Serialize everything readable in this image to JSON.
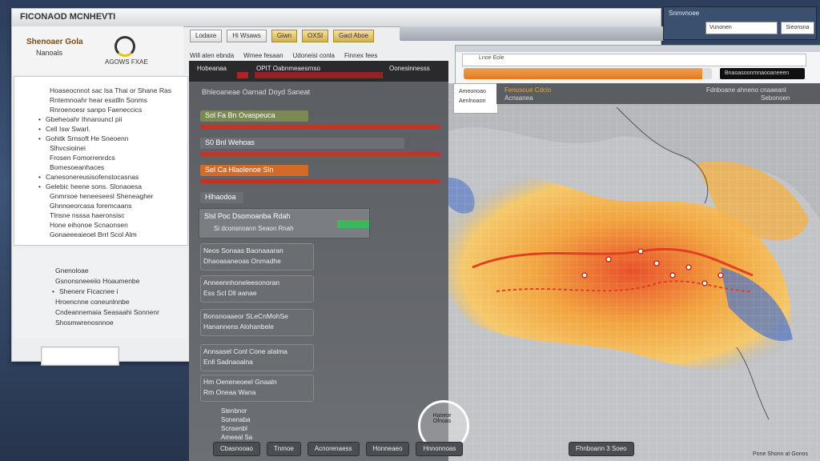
{
  "window": {
    "title": "FICONAOD MCNHEVTI"
  },
  "brand": {
    "name": "Shenoaer Gola",
    "sub": "Nanoals",
    "logo_text": "AGOWS FXAE"
  },
  "toolbar": {
    "buttons": [
      {
        "label": "Lodaxe",
        "style": "plain"
      },
      {
        "label": "Hi Wsaws",
        "style": "plain"
      },
      {
        "label": "Giwn",
        "style": "gold"
      },
      {
        "label": "OXSI",
        "style": "gold"
      },
      {
        "label": "Gacl Aboe",
        "style": "gold"
      }
    ]
  },
  "sub_toolbar": [
    "Will aten ebnda",
    "Wmee fesaan",
    "Udoneisi conla",
    "Finnex fees"
  ],
  "left_list": {
    "items": [
      {
        "text": "Hoaseocnnot sac lsa Thai or Shane Ras",
        "bullet": false
      },
      {
        "text": "Rntemnoahr hear esatlln Sonms",
        "bullet": false
      },
      {
        "text": "Rnroenoesr sanpo Faeneccics",
        "bullet": false
      },
      {
        "text": "Gbeheoahr Ihnarouncl pii",
        "bullet": true
      },
      {
        "text": "Cell Isw Swarl.",
        "bullet": true
      },
      {
        "text": "Gohitk Srnsoft He Sneoenn",
        "bullet": true
      },
      {
        "text": "Slhvcsioinei",
        "bullet": false
      },
      {
        "text": "Frosen Fomorrenrdcs",
        "bullet": false
      },
      {
        "text": "Bomesoeanhaces",
        "bullet": false
      },
      {
        "text": "Canesonereusisofenstocasnas",
        "bullet": true
      },
      {
        "text": "Gelebic heene sons. Slonaoesa",
        "bullet": true
      },
      {
        "text": "Gnmrsoe heneeseesl Sheneagher",
        "bullet": false
      },
      {
        "text": "Ghnnoeorcasa foremcaans",
        "bullet": false
      },
      {
        "text": "Tlnsne nsssa haeronsisc",
        "bullet": false
      },
      {
        "text": "Hone eihonoe Scnaonsen",
        "bullet": false
      },
      {
        "text": "Gonaeeeaieoel Brrl Scol Alm",
        "bullet": false
      }
    ]
  },
  "left_list2": {
    "items": [
      {
        "text": "Gnenoloae",
        "bullet": false
      },
      {
        "text": "Gsnonsneeeiio Hoaumenbe",
        "bullet": false
      },
      {
        "text": "Shenenr Ficacnee i",
        "bullet": true
      },
      {
        "text": "Hroencnne coneunlnnbe",
        "bullet": false
      },
      {
        "text": "Cndeannemaia Seasaahi Sonnenr",
        "bullet": false
      },
      {
        "text": "Shosmwrenosnnoe",
        "bullet": false
      }
    ]
  },
  "mid_panel": {
    "tabs": [
      "Hobeanaa",
      "OPIT Oabnmeaesrnso",
      "Oonesinnesss"
    ],
    "subtitle": "Bhleoaneae Oarnad Doyd Saneat",
    "layers": [
      {
        "label": "Sol Fa Bn Ovaspeuca",
        "color": "#7a8a50",
        "fill": 0.45,
        "strip": "#c0342a"
      },
      {
        "label": "S0 Bnl Wehoas",
        "color": "#6c6f74",
        "fill": 0.85,
        "strip": "#c0342a"
      },
      {
        "label": "Sel Ca Hlaolenoe Sln",
        "color": "#d46a2a",
        "fill": 0.45,
        "strip": "#c0342a"
      },
      {
        "label": "Hlhaodoa",
        "color": "#6c6f74",
        "fill": 0.18,
        "strip": "#7a7d82"
      }
    ],
    "legend": {
      "title": "Slsl Poc Dsomoanba Rdah",
      "sub": "Si dconsnoann Seaon Rnah"
    },
    "items": [
      "Neos Sonaas Baonaaaran",
      "Dhaoasaneoas Onmadhe",
      "Anneennhoneleesonoran",
      "Ess Scl Dll aanae",
      "Bonsnoaaeor SLeCnMohSe",
      "Hanannens Alohanbele",
      "Annsasel Conl Cone alalma",
      "Enll Sadnaoalna",
      "Hm Oeneneoeel Gnaaln",
      "Rm Oneaa Wana"
    ],
    "bottom_text": [
      "Stenbnor",
      "Sonenaba",
      "Scnsenbl",
      "Ameeal Sa"
    ]
  },
  "front": {
    "url": "Lnoe Eole",
    "progress": 0.96,
    "search_label": "Bnaoasoonmnaooaneeen",
    "popup": [
      "Ameonoao",
      "Aenlnoaon"
    ],
    "info": {
      "left": "Fenosoue Cdcio",
      "left2": "Acnsanea",
      "right": "Fdnboane ahneno cnaaeanl",
      "right2": "Sebonoen"
    }
  },
  "mini_window": {
    "title": "Snmvnoee",
    "input": "Vunonen",
    "button": "Sieonsna"
  },
  "bottom_bar": [
    "Cbasnooao",
    "Tnmoe",
    "Acnorenaess",
    "Honneaeo",
    "Hnnonnoas"
  ],
  "bottom_right": "Fhnboann 3 Soeo",
  "status_corner": "Pone Shonn at Gonos",
  "seal": "Haneor Ofnoas",
  "colors": {
    "accent": "#e07a20",
    "map_hot": "#e8502a",
    "map_warm": "#f2a540",
    "map_cool": "#4a72c8"
  }
}
